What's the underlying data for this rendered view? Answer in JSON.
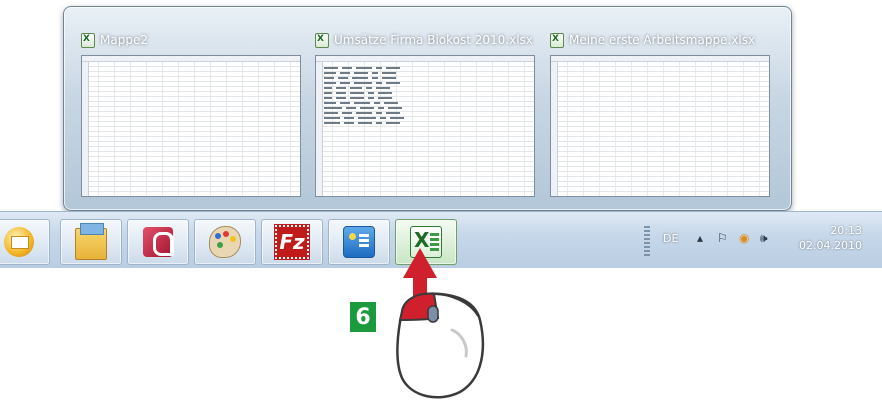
{
  "taskbar_preview": {
    "thumbnails": [
      {
        "title": "Mappe2"
      },
      {
        "title": "Umsätze Firma Biokost 2010.xlsx"
      },
      {
        "title": "Meine erste Arbeitsmappe.xlsx"
      }
    ]
  },
  "taskbar": {
    "apps": [
      {
        "name": "Outlook"
      },
      {
        "name": "Windows Explorer"
      },
      {
        "name": "Access"
      },
      {
        "name": "Paint"
      },
      {
        "name": "FileZilla",
        "glyph": "Fz"
      },
      {
        "name": "Task Manager"
      },
      {
        "name": "Excel",
        "active": true
      }
    ],
    "tray": {
      "language": "DE",
      "time": "20:13",
      "date": "02.04.2010",
      "icons": [
        "show-hidden-icons-icon",
        "action-center-flag-icon",
        "outlook-tray-icon",
        "volume-icon"
      ]
    }
  },
  "annotation": {
    "step_number": "6"
  },
  "colors": {
    "accent_red": "#d0202d",
    "step_badge_green": "#1c9a3e"
  }
}
